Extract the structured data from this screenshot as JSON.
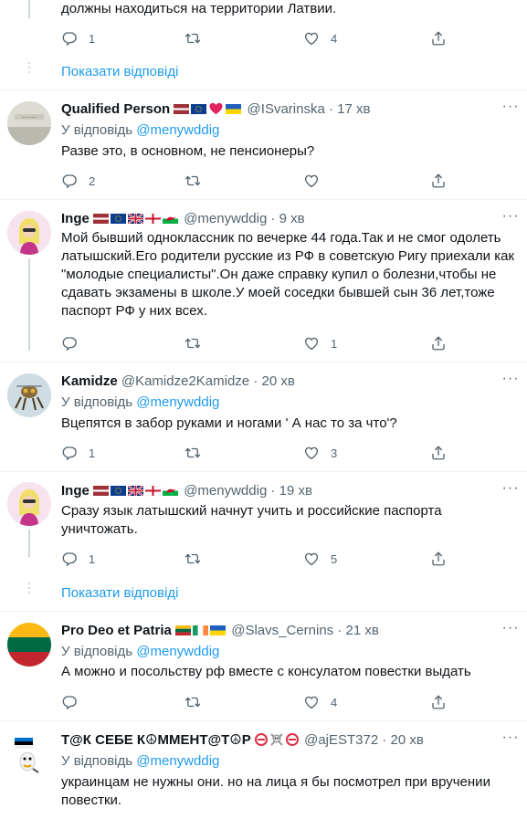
{
  "top_tweet": {
    "text": "должны находиться на территории Латвии.",
    "reply_count": "1",
    "retweet_count": "",
    "like_count": "4"
  },
  "show_replies_1": "Показати відповіді",
  "show_replies_2": "Показати відповіді",
  "reply_prefix": "У відповідь",
  "tweets": [
    {
      "name": "Qualified Person",
      "flags": [
        "latvia-flag",
        "eu-flag",
        "red-heart",
        "ukraine-flag"
      ],
      "handle": "@ISvarinska",
      "dot": "·",
      "time": "17 хв",
      "reply_to": "@menywddig",
      "text": "Разве это, в основном, не пенсионеры?",
      "reply_count": "2",
      "retweet_count": "",
      "like_count": ""
    },
    {
      "name": "Inge",
      "flags": [
        "latvia-flag",
        "eu-flag",
        "uk-flag",
        "england-flag",
        "wales-flag"
      ],
      "handle": "@menywddig",
      "dot": "·",
      "time": "9 хв",
      "reply_to": "",
      "text": "Мой бывший одноклассник по вечерке 44 года.Так и не смог одолеть латышский.Его родители русские из РФ в советскую Ригу приехали как \"молодые специалисты\".Он даже справку купил о болезни,чтобы не сдавать экзамены в школе.У моей соседки бывшей сын 36 лет,тоже паспорт РФ у них всех.",
      "reply_count": "",
      "retweet_count": "",
      "like_count": "1"
    },
    {
      "name": "Kamidze",
      "flags": [],
      "handle": "@Kamidze2Kamidze",
      "dot": "·",
      "time": "20 хв",
      "reply_to": "@menywddig",
      "text": "Вцепятся в забор руками и ногами ' А нас то за что'?",
      "reply_count": "1",
      "retweet_count": "",
      "like_count": "3"
    },
    {
      "name": "Inge",
      "flags": [
        "latvia-flag",
        "eu-flag",
        "uk-flag",
        "england-flag",
        "wales-flag"
      ],
      "handle": "@menywddig",
      "dot": "·",
      "time": "19 хв",
      "reply_to": "",
      "text": "Сразу язык латышский начнут учить и российские паспорта уничтожать.",
      "reply_count": "1",
      "retweet_count": "",
      "like_count": "5"
    },
    {
      "name": "Pro Deo et Patria",
      "flags": [
        "lithuania-flag",
        "ireland-flag",
        "ukraine-flag"
      ],
      "handle": "@Slavs_Cernins",
      "dot": "·",
      "time": "21 хв",
      "reply_to": "@menywddig",
      "text": "А можно и посольству рф вместе с консулатом повестки выдать",
      "reply_count": "",
      "retweet_count": "",
      "like_count": "4"
    },
    {
      "name": "Т@К СЕБЕ К☮ММЕНТ@Т☮Р",
      "flags": [
        "no-entry-sign",
        "skull-crossbones",
        "no-entry-sign"
      ],
      "handle": "@ajEST372",
      "dot": "·",
      "time": "20 хв",
      "reply_to": "@menywddig",
      "text": "украинцам не нужны они. но на лица я бы посмотрел при вручении повестки.",
      "reply_count": "",
      "retweet_count": "",
      "like_count": ""
    }
  ],
  "colors": {
    "link": "#1d9bf0",
    "muted": "#536471",
    "text": "#0f1419",
    "divider": "#eff3f4"
  }
}
